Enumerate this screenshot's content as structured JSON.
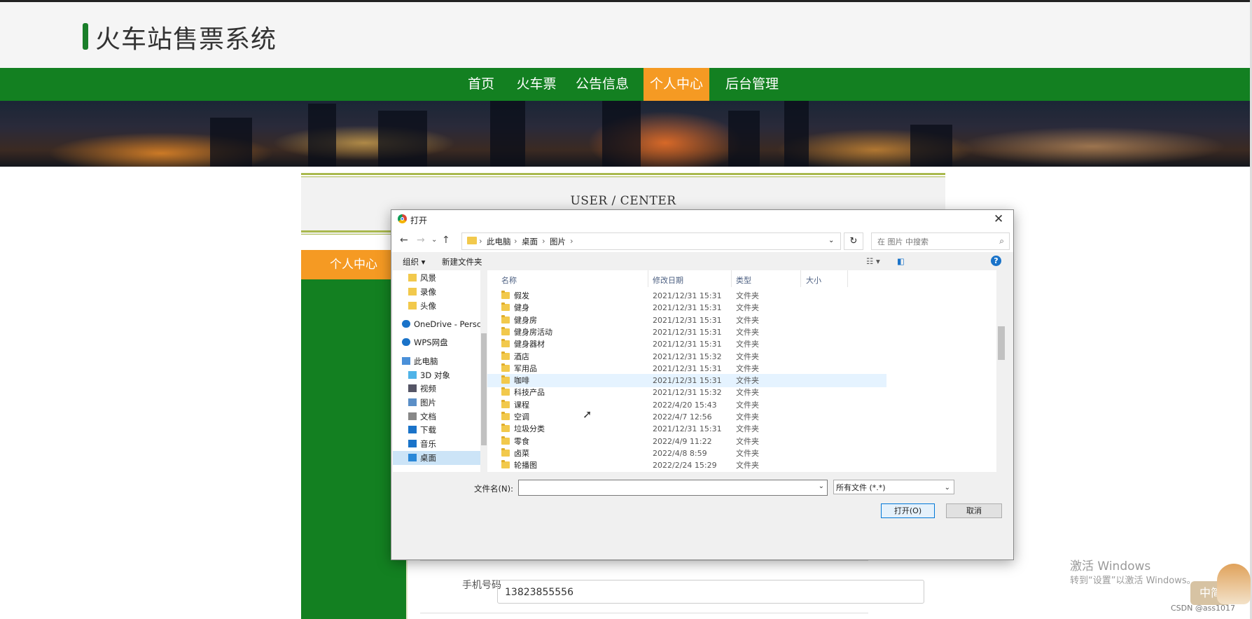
{
  "site": {
    "title": "火车站售票系统"
  },
  "nav": {
    "items": [
      "首页",
      "火车票",
      "公告信息",
      "个人中心",
      "后台管理"
    ],
    "active": "个人中心"
  },
  "user_center": {
    "title": "USER / CENTER",
    "side_item": "个人中心",
    "phone_label": "手机号码",
    "phone_value": "13823855556"
  },
  "dialog": {
    "title": "打开",
    "breadcrumb": [
      "此电脑",
      "桌面",
      "图片"
    ],
    "search_placeholder": "在 图片 中搜索",
    "toolbar": {
      "organize": "组织",
      "new_folder": "新建文件夹"
    },
    "nav_pane": [
      {
        "label": "风景",
        "icon": "folder-icon"
      },
      {
        "label": "录像",
        "icon": "folder-icon"
      },
      {
        "label": "头像",
        "icon": "folder-icon"
      },
      {
        "label": "OneDrive - Persc",
        "icon": "cloud-icon"
      },
      {
        "label": "WPS网盘",
        "icon": "cloud-icon"
      },
      {
        "label": "此电脑",
        "icon": "computer-icon"
      },
      {
        "label": "3D 对象",
        "icon": "cube-icon"
      },
      {
        "label": "视频",
        "icon": "video-icon"
      },
      {
        "label": "图片",
        "icon": "picture-icon"
      },
      {
        "label": "文档",
        "icon": "document-icon"
      },
      {
        "label": "下载",
        "icon": "download-icon"
      },
      {
        "label": "音乐",
        "icon": "music-icon"
      },
      {
        "label": "桌面",
        "icon": "desktop-icon",
        "selected": true
      }
    ],
    "columns": {
      "name": "名称",
      "date": "修改日期",
      "type": "类型",
      "size": "大小"
    },
    "files": [
      {
        "name": "假发",
        "date": "2021/12/31 15:31",
        "type": "文件夹"
      },
      {
        "name": "健身",
        "date": "2021/12/31 15:31",
        "type": "文件夹"
      },
      {
        "name": "健身房",
        "date": "2021/12/31 15:31",
        "type": "文件夹"
      },
      {
        "name": "健身房活动",
        "date": "2021/12/31 15:31",
        "type": "文件夹"
      },
      {
        "name": "健身器材",
        "date": "2021/12/31 15:31",
        "type": "文件夹"
      },
      {
        "name": "酒店",
        "date": "2021/12/31 15:32",
        "type": "文件夹"
      },
      {
        "name": "军用品",
        "date": "2021/12/31 15:31",
        "type": "文件夹"
      },
      {
        "name": "咖啡",
        "date": "2021/12/31 15:31",
        "type": "文件夹",
        "hover": true
      },
      {
        "name": "科技产品",
        "date": "2021/12/31 15:32",
        "type": "文件夹"
      },
      {
        "name": "课程",
        "date": "2022/4/20 15:43",
        "type": "文件夹"
      },
      {
        "name": "空调",
        "date": "2022/4/7 12:56",
        "type": "文件夹"
      },
      {
        "name": "垃圾分类",
        "date": "2021/12/31 15:31",
        "type": "文件夹"
      },
      {
        "name": "零食",
        "date": "2022/4/9 11:22",
        "type": "文件夹"
      },
      {
        "name": "卤菜",
        "date": "2022/4/8 8:59",
        "type": "文件夹"
      },
      {
        "name": "轮播图",
        "date": "2022/2/24 15:29",
        "type": "文件夹"
      }
    ],
    "filename_label": "文件名(N):",
    "filename_value": "",
    "filetype": "所有文件 (*.*)",
    "open_button": "打开(O)",
    "cancel_button": "取消"
  },
  "overlay": {
    "activate_title": "激活 Windows",
    "activate_sub": "转到“设置”以激活 Windows。",
    "ime": "中简",
    "watermark": "CSDN @ass1017"
  },
  "colors": {
    "nav_green": "#138021",
    "accent_orange": "#f59a23",
    "dialog_bg": "#f0f0f0",
    "hover_blue": "#e5f3ff",
    "primary_blue": "#0078d7"
  }
}
